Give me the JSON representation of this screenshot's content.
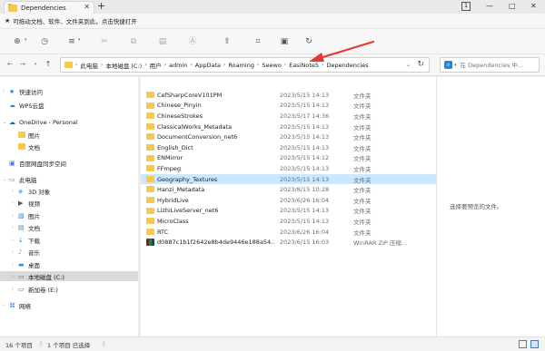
{
  "tab": {
    "title": "Dependencies",
    "close": "✕",
    "new": "+"
  },
  "window": {
    "badge": "1",
    "minimize": "—",
    "maximize": "□",
    "close": "✕"
  },
  "notice": {
    "text": "可拖动文档、软件、文件夹到此，点击快捷打开"
  },
  "address": {
    "crumbs": [
      "此电脑",
      "本地磁盘 (C:)",
      "用户",
      "admin",
      "AppData",
      "Roaming",
      "Seewo",
      "EasiNote5",
      "Dependencies"
    ]
  },
  "search": {
    "placeholder": "在 Dependencies 中..."
  },
  "sidebar": {
    "items": [
      {
        "label": "快速访问",
        "icon": "star-icon",
        "level": 0,
        "exp": "›"
      },
      {
        "label": "WPS云盘",
        "icon": "cloud-icon",
        "level": 0,
        "exp": ""
      },
      {
        "label": "OneDrive - Personal",
        "icon": "onedrive-icon",
        "level": 0,
        "exp": "⌄"
      },
      {
        "label": "图片",
        "icon": "folder-icon",
        "level": 1,
        "exp": ""
      },
      {
        "label": "文档",
        "icon": "folder-icon",
        "level": 1,
        "exp": ""
      },
      {
        "label": "百度网盘同步空间",
        "icon": "baidu-icon",
        "level": 0,
        "exp": ""
      },
      {
        "label": "此电脑",
        "icon": "pc-icon",
        "level": 0,
        "exp": "⌄"
      },
      {
        "label": "3D 对象",
        "icon": "cube-icon",
        "level": 1,
        "exp": "›"
      },
      {
        "label": "视频",
        "icon": "video-icon",
        "level": 1,
        "exp": "›"
      },
      {
        "label": "图片",
        "icon": "picture-icon",
        "level": 1,
        "exp": "›"
      },
      {
        "label": "文档",
        "icon": "document-icon",
        "level": 1,
        "exp": "›"
      },
      {
        "label": "下载",
        "icon": "download-icon",
        "level": 1,
        "exp": "›"
      },
      {
        "label": "音乐",
        "icon": "music-icon",
        "level": 1,
        "exp": "›"
      },
      {
        "label": "桌面",
        "icon": "desktop-icon",
        "level": 1,
        "exp": "›"
      },
      {
        "label": "本地磁盘 (C:)",
        "icon": "drive-icon",
        "level": 1,
        "exp": "›",
        "selected": true
      },
      {
        "label": "新加卷 (E:)",
        "icon": "drive-icon",
        "level": 1,
        "exp": "›"
      },
      {
        "label": "网络",
        "icon": "network-icon",
        "level": 0,
        "exp": "›"
      }
    ]
  },
  "files": [
    {
      "name": "CefSharpCoreV101PM",
      "date": "2023/5/15 14:13",
      "type": "文件夹",
      "kind": "folder"
    },
    {
      "name": "Chinese_Pinyin",
      "date": "2023/5/15 14:13",
      "type": "文件夹",
      "kind": "folder"
    },
    {
      "name": "ChineseStrokes",
      "date": "2023/5/17 14:36",
      "type": "文件夹",
      "kind": "folder"
    },
    {
      "name": "ClassicalWorks_Metadata",
      "date": "2023/5/15 14:13",
      "type": "文件夹",
      "kind": "folder"
    },
    {
      "name": "DocumentConversion_net6",
      "date": "2023/5/15 14:13",
      "type": "文件夹",
      "kind": "folder"
    },
    {
      "name": "English_Dict",
      "date": "2023/5/15 14:13",
      "type": "文件夹",
      "kind": "folder"
    },
    {
      "name": "ENMirror",
      "date": "2023/5/15 14:12",
      "type": "文件夹",
      "kind": "folder"
    },
    {
      "name": "FFmpeg",
      "date": "2023/5/15 14:13",
      "type": "文件夹",
      "kind": "folder"
    },
    {
      "name": "Geography_Textures",
      "date": "2023/5/15 14:13",
      "type": "文件夹",
      "kind": "folder",
      "selected": true
    },
    {
      "name": "Hanzi_Metadata",
      "date": "2023/8/15 10:28",
      "type": "文件夹",
      "kind": "folder"
    },
    {
      "name": "HybridLive",
      "date": "2023/6/26 16:04",
      "type": "文件夹",
      "kind": "folder"
    },
    {
      "name": "LizhiLiveServer_net6",
      "date": "2023/5/15 14:13",
      "type": "文件夹",
      "kind": "folder"
    },
    {
      "name": "MicroClass",
      "date": "2023/5/15 14:13",
      "type": "文件夹",
      "kind": "folder"
    },
    {
      "name": "RTC",
      "date": "2023/6/26 16:04",
      "type": "文件夹",
      "kind": "folder"
    },
    {
      "name": "d0887c1b1f2642e8b4de9446e188a54...",
      "date": "2023/6/15 16:03",
      "type": "WinRAR ZIP 压缩...",
      "kind": "zip"
    }
  ],
  "preview": {
    "message": "选择要预览的文件。"
  },
  "status": {
    "count": "16 个项目",
    "selected": "1 个项目 已选择"
  },
  "colors": {
    "folder": "#f6c84e",
    "selected_row": "#cce8ff",
    "arrow": "#e53935",
    "accent": "#1e88e5"
  }
}
